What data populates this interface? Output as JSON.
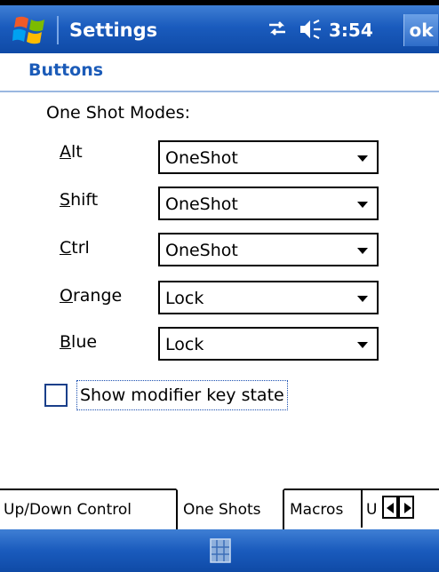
{
  "titlebar": {
    "title": "Settings",
    "clock": "3:54",
    "ok_label": "ok"
  },
  "header": {
    "title": "Buttons"
  },
  "section_label": "One Shot Modes:",
  "rows": [
    {
      "label": "Alt",
      "ul": "A",
      "rest": "lt",
      "value": "OneShot"
    },
    {
      "label": "Shift",
      "ul": "S",
      "rest": "hift",
      "value": "OneShot"
    },
    {
      "label": "Ctrl",
      "ul": "C",
      "rest": "trl",
      "value": "OneShot"
    },
    {
      "label": "Orange",
      "ul": "O",
      "rest": "range",
      "value": "Lock"
    },
    {
      "label": "Blue",
      "ul": "B",
      "rest": "lue",
      "value": "Lock"
    }
  ],
  "checkbox": {
    "label": "Show modifier key state",
    "checked": false
  },
  "tabs": [
    {
      "label": "Up/Down Control",
      "active": false
    },
    {
      "label": "One Shots",
      "active": true
    },
    {
      "label": "Macros",
      "active": false
    },
    {
      "label": "U",
      "active": false
    }
  ],
  "colors": {
    "accent": "#1b5bb8",
    "titlebar": "#1a5bbd"
  }
}
